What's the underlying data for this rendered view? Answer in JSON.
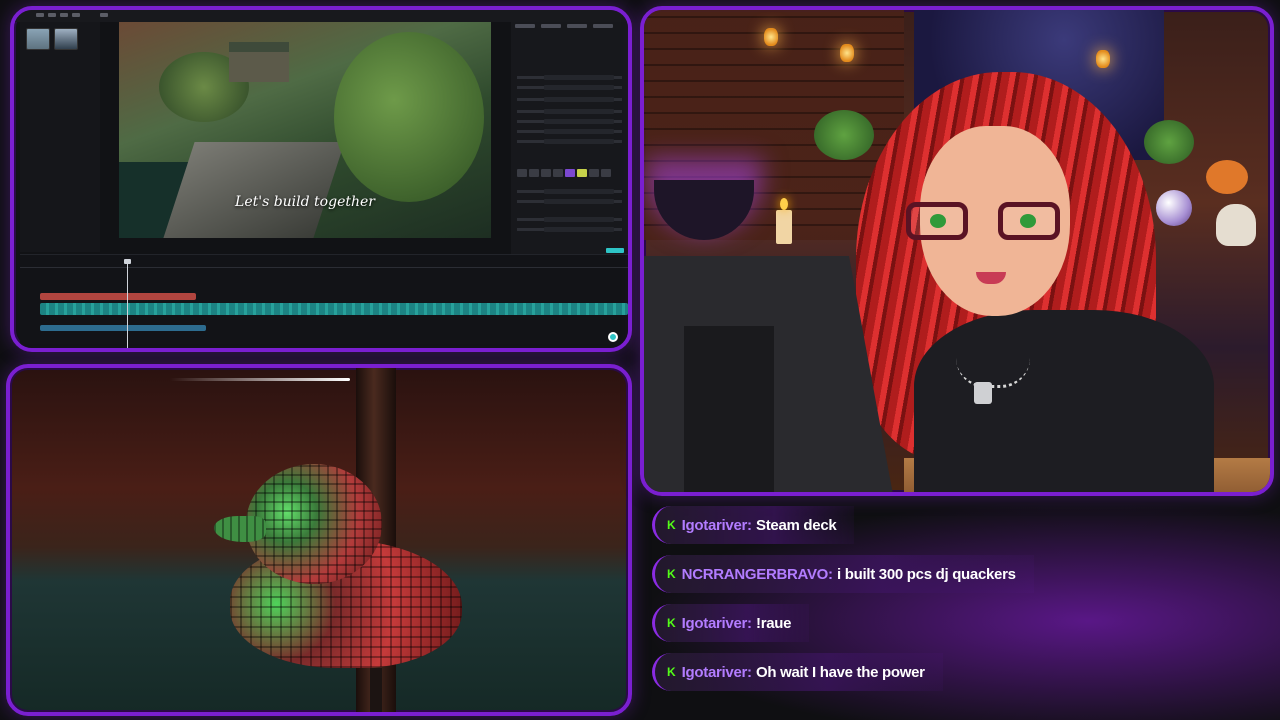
{
  "editor": {
    "subtitle": "Let's build together"
  },
  "chat": {
    "platform_icon": "kick-icon",
    "accent": "#53fc18",
    "messages": [
      {
        "user": "Igotariver",
        "text": "Steam deck"
      },
      {
        "user": "NCRRANGERBRAVO",
        "text": "i built 300 pcs dj quackers"
      },
      {
        "user": "Igotariver",
        "text": "!raue"
      },
      {
        "user": "Igotariver",
        "text": "Oh wait I have the power"
      }
    ]
  },
  "theme": {
    "frame_color": "#7a1fd1",
    "username_color": "#b27cff"
  }
}
